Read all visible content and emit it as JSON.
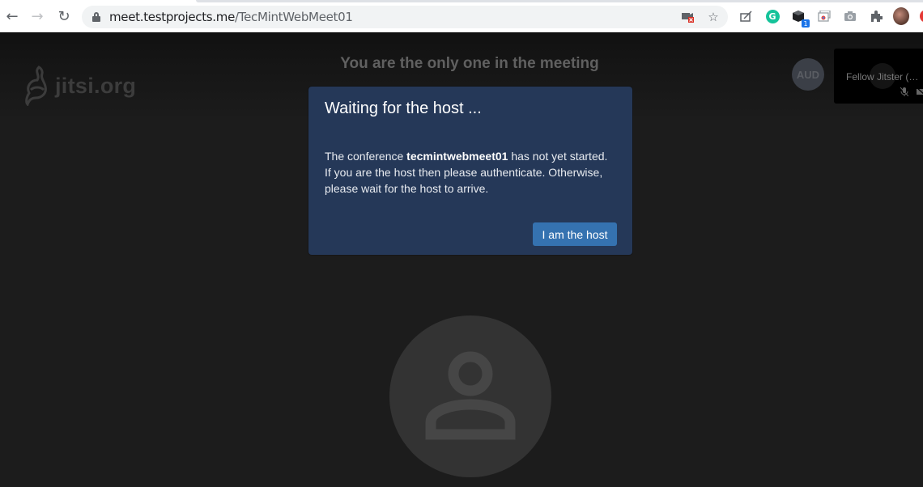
{
  "browser": {
    "url_host": "meet.testprojects.me",
    "url_path": "/TecMintWebMeet01",
    "nav": {
      "back_icon": "arrow-left-icon",
      "forward_icon": "arrow-right-icon",
      "reload_icon": "reload-icon"
    },
    "omnibox_icons": [
      "camera-blocked-icon",
      "star-icon"
    ],
    "extensions": [
      {
        "name": "edit-extension-icon"
      },
      {
        "name": "grammarly-icon",
        "label": "G"
      },
      {
        "name": "cube-extension-icon",
        "badge": "1"
      },
      {
        "name": "cast-extension-icon"
      },
      {
        "name": "camera-extension-icon"
      },
      {
        "name": "puzzle-extensions-icon"
      },
      {
        "name": "profile-avatar"
      }
    ]
  },
  "jitsi": {
    "logo_text": "jitsi.org",
    "subject": "You are the only one in the meeting",
    "remote_avatar_initials": "AUD",
    "local_thumbnail": {
      "name": "Fellow Jitster (…",
      "status_icons": [
        "mic-muted-icon",
        "camera-off-icon"
      ]
    }
  },
  "dialog": {
    "title": "Waiting for the host ...",
    "body_prefix": "The conference ",
    "room_name": "tecmintwebmeet01",
    "body_suffix": " has not yet started. If you are the host then please authenticate. Otherwise, please wait for the host to arrive.",
    "button_label": "I am the host"
  },
  "colors": {
    "dialog_bg": "#253858",
    "button_bg": "#3572b0",
    "page_bg": "#1c1c1c"
  }
}
